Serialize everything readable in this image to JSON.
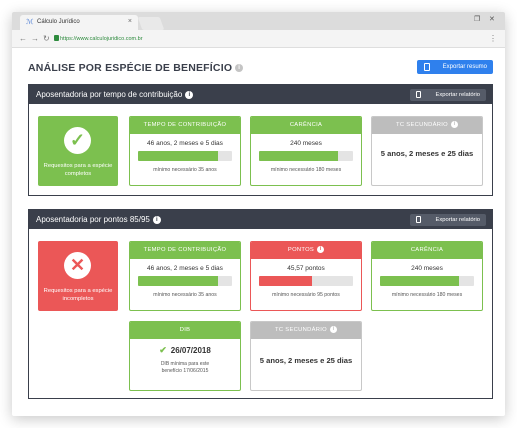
{
  "browser": {
    "tab_title": "Cálculo Jurídico",
    "tab_close": "×",
    "url": "https://www.calculojuridico.com.br",
    "nav": {
      "back": "←",
      "forward": "→",
      "reload": "↻"
    },
    "win_restore": "❐",
    "win_close": "✕",
    "menu": "⋮",
    "favicon": "ℳ"
  },
  "header": {
    "title": "ANÁLISE POR ESPÉCIE DE BENEFÍCIO",
    "info": "i",
    "export_summary_label": "Exportar resumo"
  },
  "sections": [
    {
      "title": "Aposentadoria por tempo de contribuição",
      "export_label": "Exportar relatório",
      "status": {
        "kind": "ok",
        "symbol": "✓",
        "label": "Requesitos para a espécie completos"
      },
      "cards": [
        {
          "title": "TEMPO DE CONTRIBUIÇÃO",
          "value": "46 anos, 2 meses e 5 dias",
          "progress": 0.85,
          "min": "mínimo necessário 35 anos"
        },
        {
          "title": "CARÊNCIA",
          "value": "240 meses",
          "progress": 0.84,
          "min": "mínimo necessário 180 meses"
        },
        {
          "title": "TC SECUNDÁRIO",
          "value": "5 anos, 2 meses e 25 dias"
        }
      ]
    },
    {
      "title": "Aposentadoria por pontos 85/95",
      "export_label": "Exportar relatório",
      "status": {
        "kind": "bad",
        "symbol": "✕",
        "label": "Requesitos para a espécie incompletos"
      },
      "cards": [
        {
          "title": "TEMPO DE CONTRIBUIÇÃO",
          "value": "46 anos, 2 meses e 5 dias",
          "progress": 0.85,
          "min": "mínimo necessário 35 anos"
        },
        {
          "title": "PONTOS",
          "value": "45,57 pontos",
          "progress": 0.56,
          "min": "mínimo necessário 95 pontos"
        },
        {
          "title": "CARÊNCIA",
          "value": "240 meses",
          "progress": 0.84,
          "min": "mínimo necessário 180 meses"
        },
        {
          "title": "DIB",
          "value": "26/07/2018",
          "note": "DIB mínima para este benefício 17/06/2015"
        },
        {
          "title": "TC SECUNDÁRIO",
          "value": "5 anos, 2 meses e 25 dias"
        }
      ]
    }
  ],
  "colors": {
    "ok": "#7cc04f",
    "bad": "#eb5757",
    "neutral": "#bdbdbd",
    "section_header": "#3a3f4b",
    "primary_button": "#2f80ed"
  }
}
